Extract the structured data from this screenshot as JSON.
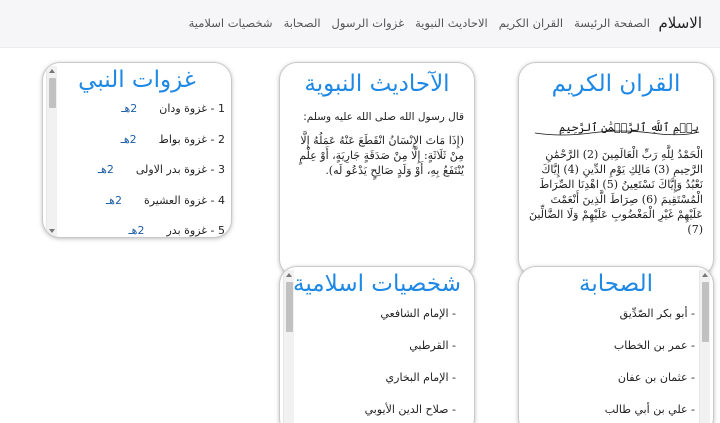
{
  "navbar": {
    "brand": "الاسلام",
    "links": [
      "الصفحة الرئيسة",
      "القران الكريم",
      "الاحاديث النبوية",
      "غزوات الرسول",
      "الصحابة",
      "شخصيات اسلامية"
    ]
  },
  "quran": {
    "title": "القران الكريم",
    "bismillah": "بِسۡمِ ٱللَّهِ ٱلرَّحۡمَٰنِ ٱلرَّحِيمِ",
    "text": "الْحَمْدُ لِلَّهِ رَبِّ الْعَالَمِينَ (2) الرَّحْمَٰنِ الرَّحِيمِ (3) مَالِكِ يَوْمِ الدِّينِ (4) إِيَّاكَ نَعْبُدُ وَإِيَّاكَ نَسْتَعِينُ (5) اهْدِنَا الصِّرَاطَ الْمُسْتَقِيمَ (6) صِرَاطَ الَّذِينَ أَنْعَمْتَ عَلَيْهِمْ غَيْرِ الْمَغْضُوبِ عَلَيْهِمْ وَلَا الضَّالِّينَ (7)"
  },
  "hadith": {
    "title": "الآحاديث النبوية",
    "intro": "قال رسول الله صلى الله عليه وسلم:",
    "text": "(إِذَا مَاتَ الإِنْسَانُ انْقَطَعَ عَنْهُ عَمَلُهُ إِلَّا مِنْ ثَلَاثَةٍ: إِلَّا مِنْ صَدَقَةٍ جَارِيَةٍ، أَوْ عِلْمٍ يُنْتَفَعُ بِهِ، أَوْ وَلَدٍ صَالِحٍ يَدْعُو لَه)."
  },
  "battles": {
    "title": "غزوات النبي",
    "items": [
      {
        "label": "1 - غزوة ودان",
        "date": "2هـ"
      },
      {
        "label": "2 - غزوة بواط",
        "date": "2هـ"
      },
      {
        "label": "3 - غزوة بدر الاولى",
        "date": "2هـ"
      },
      {
        "label": "4 - غزوة العشيرة",
        "date": "2هـ"
      },
      {
        "label": "5 - غزوة بدر",
        "date": "2هـ"
      }
    ]
  },
  "companions": {
    "title": "الصحابة",
    "items": [
      "- أبو بكر الصّدِّيق",
      "- عمر بن الخطاب",
      "- عثمان بن عفان",
      "- علي بن أبي طالب"
    ]
  },
  "figures": {
    "title": "شخصيات اسلامية",
    "items": [
      "- الإمام الشافعي",
      "- القرطبي",
      "- الإمام البخاري",
      "- صلاح الدين الأيوبي"
    ]
  },
  "colors": {
    "title_blue": "#1e88e5",
    "date_blue": "#1e5fa8",
    "navbar_bg": "#f6f6f8"
  }
}
